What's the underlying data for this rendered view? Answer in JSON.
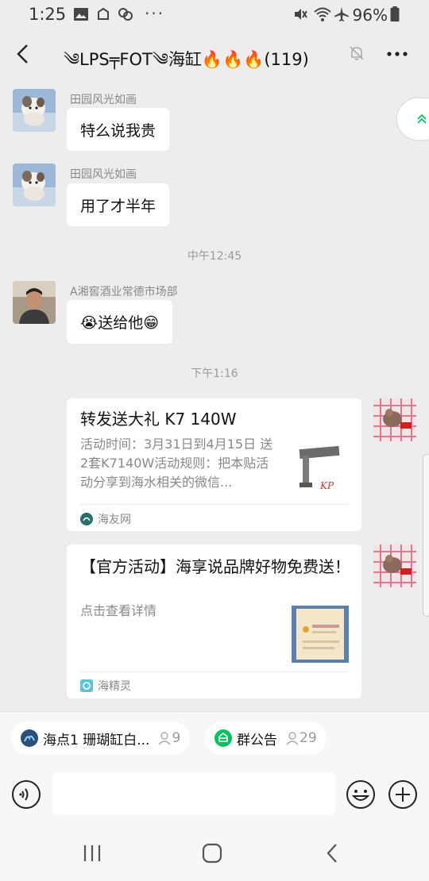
{
  "status_bar": {
    "time": "1:25",
    "battery": "96%",
    "dots": "···"
  },
  "header": {
    "title": "༄LPS╤FOT༄海缸🔥🔥🔥(119)"
  },
  "messages": [
    {
      "sender": "田园风光如画",
      "text": "特么说我贵"
    },
    {
      "sender": "田园风光如画",
      "text": "用了才半年"
    },
    {
      "time": "中午12:45"
    },
    {
      "sender": "A湘窖酒业常德市场部",
      "text": "😭送给他😁"
    },
    {
      "time": "下午1:16"
    }
  ],
  "cards": [
    {
      "title": "转发送大礼 K7 140W",
      "desc": "活动时间：3月31日到4月15日 送2套K7140W活动规则：把本贴活动分享到海水相关的微信...",
      "source": "海友网"
    },
    {
      "title": "【官方活动】海享说品牌好物免费送！",
      "desc": "点击查看详情",
      "source": "海精灵"
    }
  ],
  "chips": [
    {
      "label": "海点1 珊瑚缸白...",
      "count": "9"
    },
    {
      "label": "群公告",
      "count": "29"
    }
  ],
  "input": {
    "placeholder": ""
  },
  "colors": {
    "background": "#ededed",
    "bubble": "#ffffff",
    "accent_green": "#07c160"
  }
}
